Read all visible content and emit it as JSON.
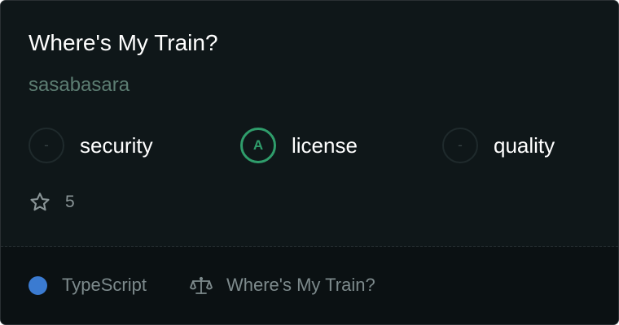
{
  "repo": {
    "title": "Where's My Train?",
    "owner": "sasabasara"
  },
  "scores": [
    {
      "grade": "-",
      "label": "security"
    },
    {
      "grade": "A",
      "label": "license"
    },
    {
      "grade": "-",
      "label": "quality"
    }
  ],
  "stars": {
    "icon": "star-icon",
    "count": "5"
  },
  "footer": {
    "language": "TypeScript",
    "language_color": "#3b7bd1",
    "license_icon": "scale-icon",
    "license": "Where's My Train?"
  },
  "colors": {
    "background": "#0f1719",
    "footer_background": "#0b1113",
    "grade_good": "#2f9d6b",
    "owner_text": "#5c7d72"
  }
}
